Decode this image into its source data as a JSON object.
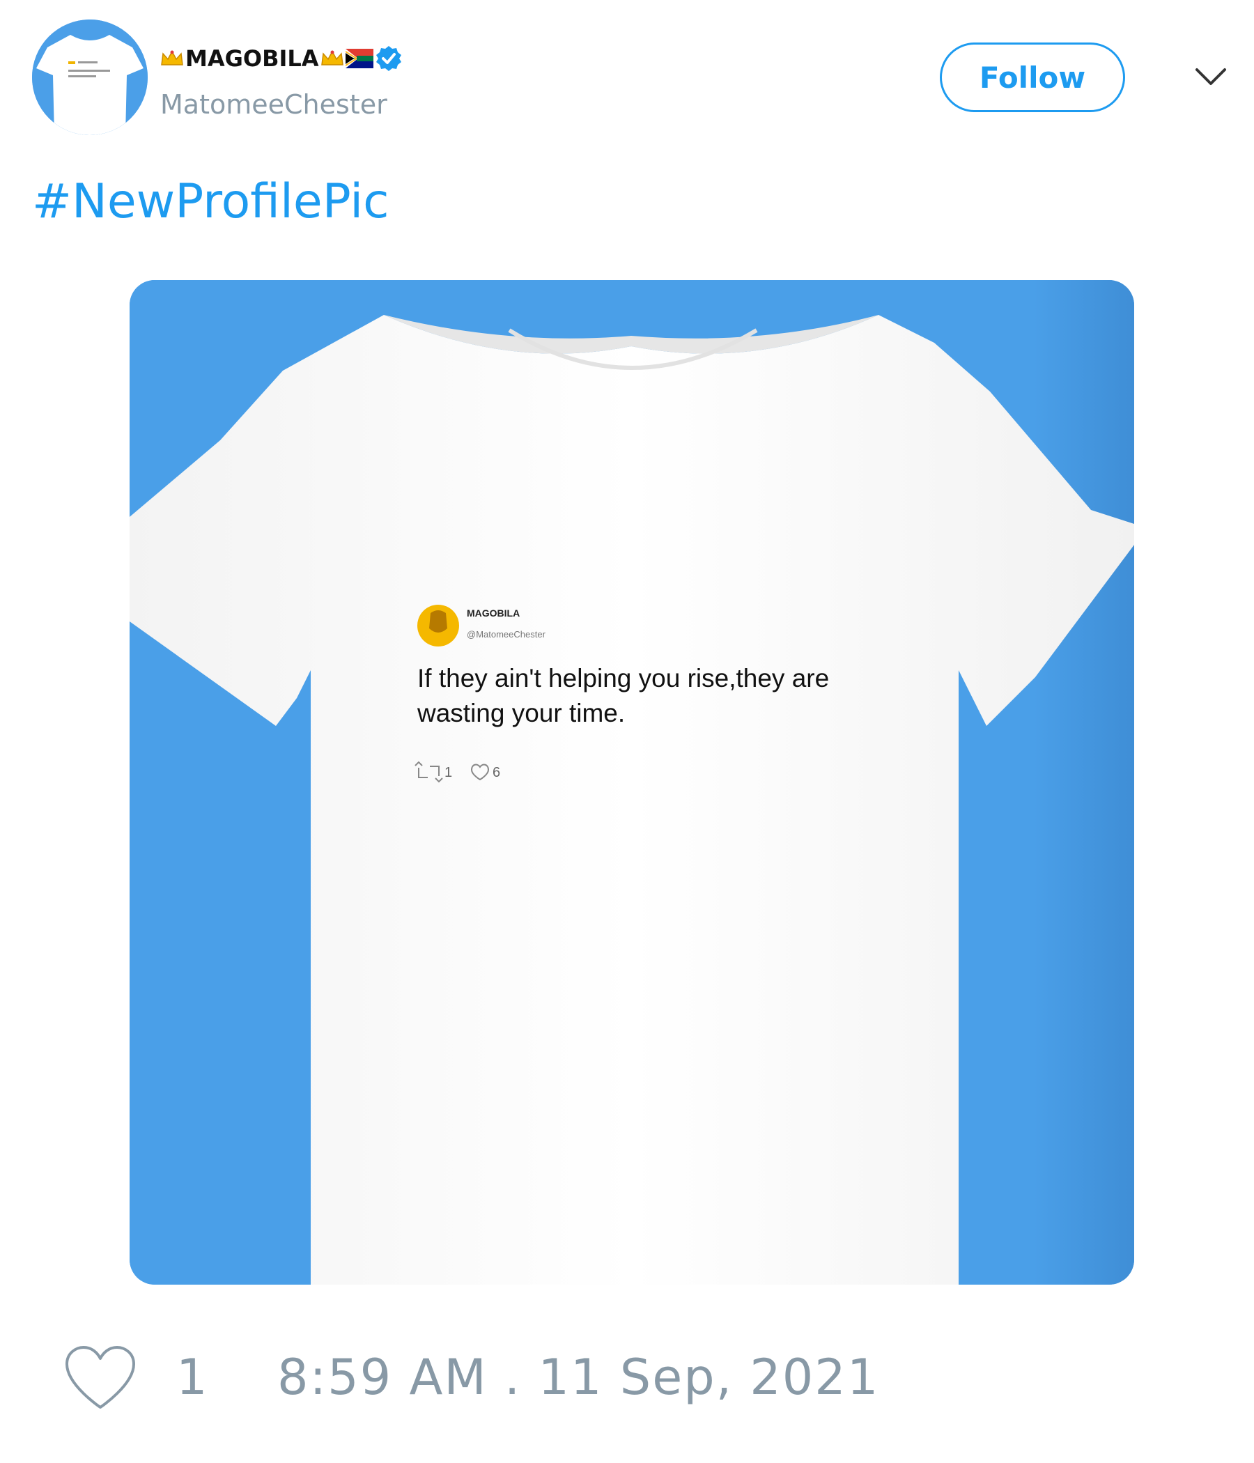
{
  "colors": {
    "accent": "#1d9bf0",
    "muted": "#8899a6",
    "media_background": "#4a9fe8",
    "verified": "#1d9bf0"
  },
  "tweet": {
    "author": {
      "display_name": "MAGOBILA",
      "handle": "MatomeeChester",
      "avatar_icon": "tshirt-avatar",
      "verified": true,
      "decorations": [
        "crown-emoji",
        "crown-emoji",
        "south-africa-flag-emoji",
        "verified-badge-icon"
      ]
    },
    "follow_label": "Follow",
    "more_icon": "chevron-down-icon",
    "text": "#NewProfilePic",
    "media": {
      "icon": "white-tshirt-photo",
      "printed_tweet": {
        "name": "MAGOBILA",
        "handle": "@MatomeeChester",
        "line1": "If they ain't helping you rise,they are",
        "line2": "wasting your time.",
        "retweets": "1",
        "likes": "6"
      }
    },
    "footer": {
      "like_icon": "heart-icon",
      "like_count": "1",
      "timestamp": "8:59 AM . 11 Sep, 2021"
    }
  }
}
